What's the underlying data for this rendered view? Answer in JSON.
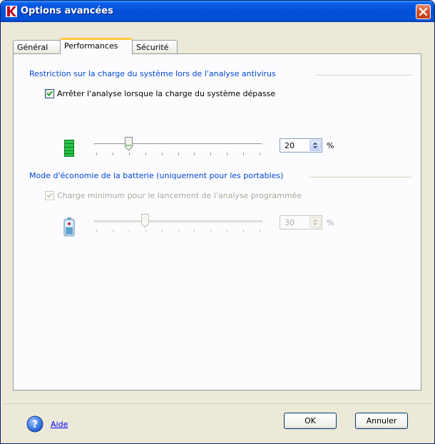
{
  "window": {
    "title": "Options avancées"
  },
  "tabs": [
    {
      "label": "Général"
    },
    {
      "label": "Performances"
    },
    {
      "label": "Sécurité"
    }
  ],
  "active_tab": "Performances",
  "system_load": {
    "group_title": "Restriction sur la charge du système lors de l'analyse antivirus",
    "checkbox_label": "Arrêter l'analyse lorsque la charge du système dépasse",
    "checked": true,
    "value": "20",
    "unit": "%",
    "slider_position_percent": 20
  },
  "battery": {
    "group_title": "Mode d'économie de la batterie (uniquement pour les portables)",
    "checkbox_label": "Charge minimum pour le lancement de l'analyse programmée",
    "checked": true,
    "enabled": false,
    "value": "30",
    "unit": "%",
    "slider_position_percent": 30
  },
  "footer": {
    "help_label": "Aide",
    "ok_label": "OK",
    "cancel_label": "Annuler"
  },
  "colors": {
    "accent": "#0046d5",
    "title_bar": "#0350d8",
    "load_icon": "#1fb23a"
  },
  "icons": {
    "app": "kaspersky-logo-icon",
    "close": "close-icon",
    "load": "system-load-icon",
    "battery": "battery-icon",
    "help": "help-icon"
  }
}
